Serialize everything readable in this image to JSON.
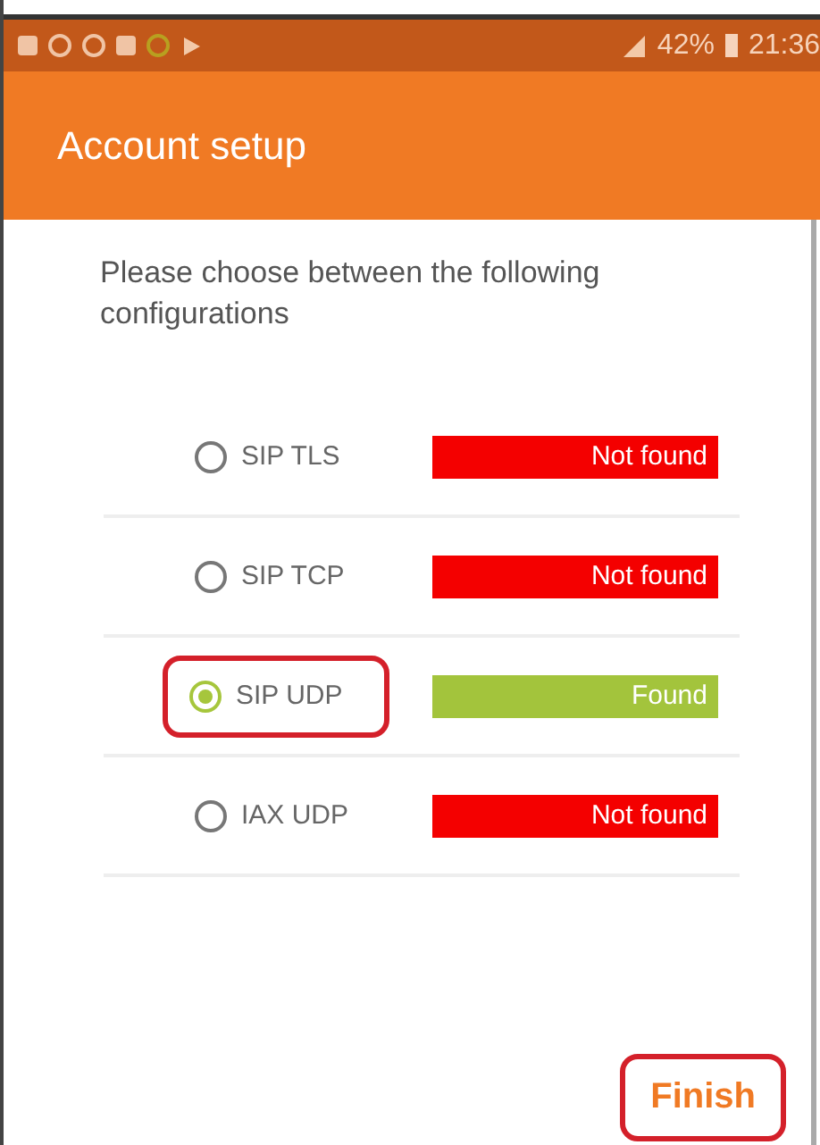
{
  "status_bar": {
    "battery": "42%",
    "time": "21:36"
  },
  "app_bar": {
    "title": "Account setup"
  },
  "prompt": "Please choose between the following configurations",
  "options": [
    {
      "label": "SIP TLS",
      "selected": false,
      "status": "Not found",
      "found": false
    },
    {
      "label": "SIP TCP",
      "selected": false,
      "status": "Not found",
      "found": false
    },
    {
      "label": "SIP UDP",
      "selected": true,
      "status": "Found",
      "found": true
    },
    {
      "label": "IAX UDP",
      "selected": false,
      "status": "Not found",
      "found": false
    }
  ],
  "finish_button": "Finish"
}
